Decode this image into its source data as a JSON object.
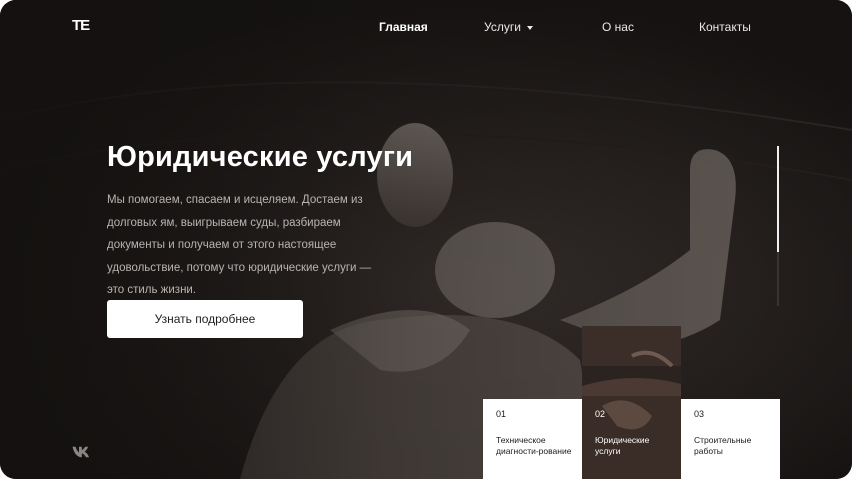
{
  "brand": {
    "logo_text": "TE"
  },
  "nav": {
    "items": [
      {
        "label": "Главная",
        "active": true
      },
      {
        "label": "Услуги",
        "has_dropdown": true
      },
      {
        "label": "О нас"
      },
      {
        "label": "Контакты"
      }
    ]
  },
  "hero": {
    "title": "Юридические услуги",
    "text": "Мы помогаем, спасаем и исцеляем. Достаем из долговых ям, выигрываем суды, разбираем документы и получаем от этого настоящее удовольствие, потому что юридические услуги — это стиль жизни.",
    "cta_label": "Узнать подробнее"
  },
  "slider": {
    "progress": 0.66
  },
  "social": {
    "icon": "vk-icon"
  },
  "services": [
    {
      "num": "01",
      "label": "Техническое диагности-рование"
    },
    {
      "num": "02",
      "label": "Юридические услуги"
    },
    {
      "num": "03",
      "label": "Строительные работы"
    }
  ],
  "colors": {
    "background": "#161312",
    "text": "#ffffff",
    "muted_text": "#b9b4b0",
    "card": "#ffffff"
  }
}
